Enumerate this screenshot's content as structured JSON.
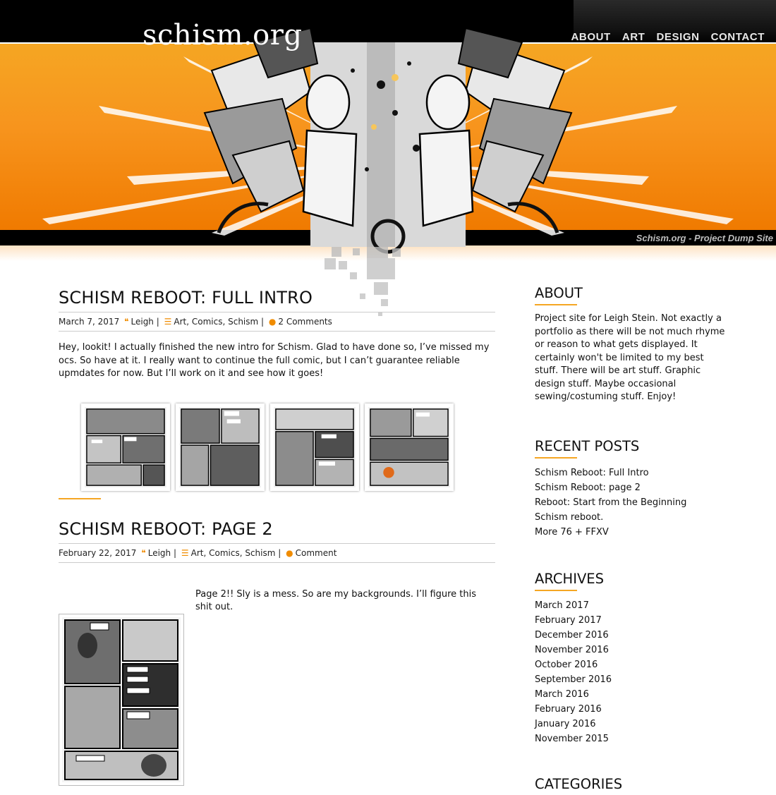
{
  "site": {
    "logo": "schism.org",
    "tagline": "Schism.org - Project Dump Site"
  },
  "nav": [
    "ABOUT",
    "ART",
    "DESIGN",
    "CONTACT"
  ],
  "colors": {
    "accent": "#f7941d",
    "header_black": "#000000",
    "meta_icon": "#f08c00"
  },
  "posts": [
    {
      "title": "SCHISM REBOOT: FULL INTRO",
      "date": "March 7, 2017",
      "author": "Leigh",
      "categories": [
        "Art",
        "Comics",
        "Schism"
      ],
      "comments": "2 Comments",
      "body": "Hey, lookit! I actually finished the new intro for Schism. Glad to have done so, I’ve missed my ocs. So have at it. I really want to continue the full comic, but I can’t guarantee reliable upmdates for now. But I’ll work on it and see how it goes!",
      "gallery_count": 4
    },
    {
      "title": "SCHISM REBOOT: PAGE 2",
      "date": "February 22, 2017",
      "author": "Leigh",
      "categories": [
        "Art",
        "Comics",
        "Schism"
      ],
      "comments": "Comment",
      "body": "Page 2!! Sly is a mess. So are my backgrounds. I’ll figure this shit out."
    }
  ],
  "meta_icons": {
    "author": "quote-icon",
    "category": "list-icon",
    "comments": "speech-bubble-icon"
  },
  "sidebar": {
    "about": {
      "title": "ABOUT",
      "text": "Project site for Leigh Stein. Not exactly a portfolio as there will be not much rhyme or reason to what gets displayed. It certainly won't be limited to my best stuff. There will be art stuff. Graphic design stuff. Maybe occasional sewing/costuming stuff. Enjoy!"
    },
    "recent_posts": {
      "title": "RECENT POSTS",
      "items": [
        "Schism Reboot: Full Intro",
        "Schism Reboot: page 2",
        "Reboot: Start from the Beginning",
        "Schism reboot.",
        "More 76 + FFXV"
      ]
    },
    "archives": {
      "title": "ARCHIVES",
      "items": [
        "March 2017",
        "February 2017",
        "December 2016",
        "November 2016",
        "October 2016",
        "September 2016",
        "March 2016",
        "February 2016",
        "January 2016",
        "November 2015"
      ]
    },
    "categories": {
      "title": "CATEGORIES"
    }
  }
}
